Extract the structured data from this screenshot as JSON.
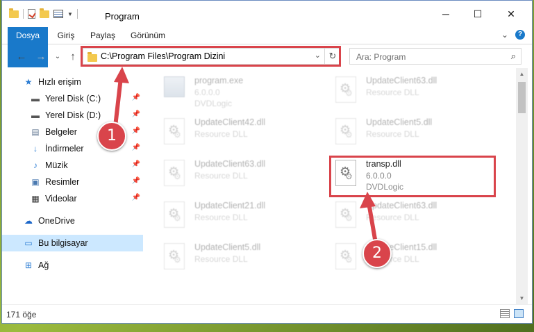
{
  "window": {
    "title": "Program",
    "minimize": "─",
    "maximize": "☐",
    "close": "✕"
  },
  "ribbon": {
    "tabs": [
      "Dosya",
      "Giriş",
      "Paylaş",
      "Görünüm"
    ],
    "expand": "⌄",
    "help": "?"
  },
  "address": {
    "path": "C:\\Program Files\\Program Dizini",
    "dropdown": "⌄",
    "refresh": "↻",
    "back": "←",
    "forward": "→",
    "recent": "⌄",
    "up": "↑"
  },
  "search": {
    "placeholder": "Ara: Program",
    "icon": "⌕"
  },
  "nav": {
    "items": [
      {
        "label": "Hızlı erişim",
        "icon": "star-icon"
      },
      {
        "label": "Yerel Disk (C:)",
        "icon": "drive-icon",
        "pinned": true
      },
      {
        "label": "Yerel Disk (D:)",
        "icon": "drive-icon",
        "pinned": true
      },
      {
        "label": "Belgeler",
        "icon": "document-icon",
        "pinned": true
      },
      {
        "label": "İndirmeler",
        "icon": "download-icon",
        "pinned": true
      },
      {
        "label": "Müzik",
        "icon": "music-icon",
        "pinned": true
      },
      {
        "label": "Resimler",
        "icon": "picture-icon",
        "pinned": true
      },
      {
        "label": "Videolar",
        "icon": "video-icon",
        "pinned": true
      },
      {
        "label": "OneDrive",
        "icon": "cloud-icon"
      },
      {
        "label": "Bu bilgisayar",
        "icon": "computer-icon",
        "selected": true
      },
      {
        "label": "Ağ",
        "icon": "network-icon"
      }
    ]
  },
  "files": [
    {
      "name": "program.exe",
      "line2": "6.0.0.0",
      "line3": "DVDLogic",
      "type": "exe"
    },
    {
      "name": "UpdateClient63.dll",
      "line2": "Resource DLL",
      "type": "dll"
    },
    {
      "name": "UpdateClient42.dll",
      "line2": "Resource DLL",
      "type": "dll"
    },
    {
      "name": "UpdateClient5.dll",
      "line2": "Resource DLL",
      "type": "dll"
    },
    {
      "name": "UpdateClient63.dll",
      "line2": "Resource DLL",
      "type": "dll"
    },
    {
      "name": "transp.dll",
      "line2": "6.0.0.0",
      "line3": "DVDLogic",
      "type": "dll",
      "highlighted": true
    },
    {
      "name": "UpdateClient21.dll",
      "line2": "Resource DLL",
      "type": "dll"
    },
    {
      "name": "UpdateClient63.dll",
      "line2": "Resource DLL",
      "type": "dll"
    },
    {
      "name": "UpdateClient5.dll",
      "line2": "Resource DLL",
      "type": "dll"
    },
    {
      "name": "UpdateClient15.dll",
      "line2": "Resource DLL",
      "type": "dll"
    }
  ],
  "status": {
    "count": "171 öğe"
  },
  "callouts": {
    "step1": "1",
    "step2": "2",
    "color": "#d9444b"
  }
}
